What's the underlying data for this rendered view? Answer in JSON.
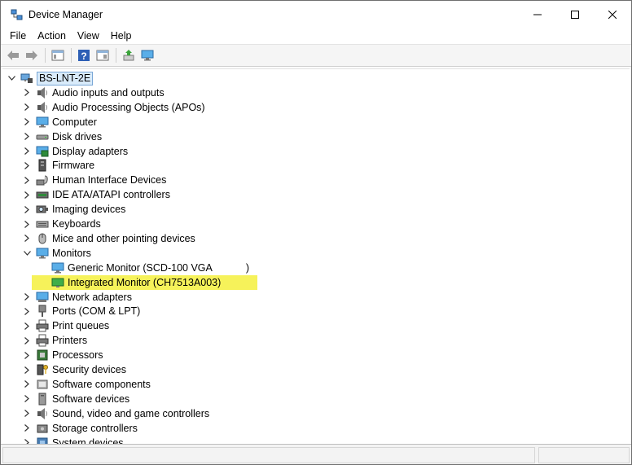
{
  "window": {
    "title": "Device Manager"
  },
  "menu": [
    "File",
    "Action",
    "View",
    "Help"
  ],
  "toolbar": [
    "back-icon",
    "forward-icon",
    "properties-icon",
    "help-icon",
    "show-hide-icon",
    "update-driver-icon",
    "scan-hardware-icon"
  ],
  "tree": {
    "root": "BS-LNT-2E",
    "categories": [
      {
        "label": "Audio inputs and outputs",
        "icon": "speaker-icon"
      },
      {
        "label": "Audio Processing Objects (APOs)",
        "icon": "speaker-icon"
      },
      {
        "label": "Computer",
        "icon": "computer-icon"
      },
      {
        "label": "Disk drives",
        "icon": "disk-drive-icon"
      },
      {
        "label": "Display adapters",
        "icon": "display-adapter-icon"
      },
      {
        "label": "Firmware",
        "icon": "firmware-icon"
      },
      {
        "label": "Human Interface Devices",
        "icon": "hid-icon"
      },
      {
        "label": "IDE ATA/ATAPI controllers",
        "icon": "ide-controller-icon"
      },
      {
        "label": "Imaging devices",
        "icon": "camera-icon"
      },
      {
        "label": "Keyboards",
        "icon": "keyboard-icon"
      },
      {
        "label": "Mice and other pointing devices",
        "icon": "mouse-icon"
      },
      {
        "label": "Monitors",
        "icon": "monitor-icon",
        "expanded": true,
        "children": [
          {
            "label": "Generic Monitor (SCD-100 VGA            )",
            "icon": "monitor-icon"
          },
          {
            "label": "Integrated Monitor (CH7513A003)",
            "icon": "monitor-green-icon",
            "highlighted": true
          }
        ]
      },
      {
        "label": "Network adapters",
        "icon": "network-adapter-icon"
      },
      {
        "label": "Ports (COM & LPT)",
        "icon": "port-icon"
      },
      {
        "label": "Print queues",
        "icon": "printer-icon"
      },
      {
        "label": "Printers",
        "icon": "printer-icon"
      },
      {
        "label": "Processors",
        "icon": "processor-icon"
      },
      {
        "label": "Security devices",
        "icon": "security-icon"
      },
      {
        "label": "Software components",
        "icon": "software-component-icon"
      },
      {
        "label": "Software devices",
        "icon": "software-device-icon"
      },
      {
        "label": "Sound, video and game controllers",
        "icon": "speaker-icon"
      },
      {
        "label": "Storage controllers",
        "icon": "storage-icon"
      },
      {
        "label": "System devices",
        "icon": "system-device-icon"
      }
    ]
  },
  "colors": {
    "highlight": "#f6f25a",
    "root_selection": "#d9ebfa",
    "accent_blue": "#3b8fd9"
  }
}
